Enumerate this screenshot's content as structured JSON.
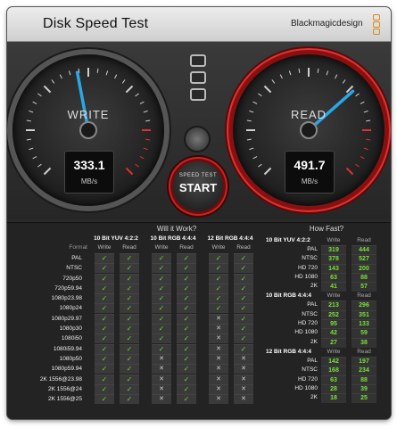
{
  "window": {
    "title": "Disk Speed Test",
    "brand": "Blackmagicdesign"
  },
  "colors": {
    "accent_needle": "#2aa7e8",
    "read_ring": "#d33333",
    "check_green": "#6fd03a",
    "value_green": "#7be03a"
  },
  "gauges": {
    "write": {
      "label": "WRITE",
      "value": "333.1",
      "unit": "MB/s",
      "level": 0.46
    },
    "read": {
      "label": "READ",
      "value": "491.7",
      "unit": "MB/s",
      "level": 0.68
    }
  },
  "controls": {
    "start_small": "SPEED TEST",
    "start_big": "START",
    "settings_icon": "settings-stack-icon",
    "gear_icon": "gear-icon"
  },
  "will_it_work": {
    "title": "Will it Work?",
    "format_header": "Format",
    "groups": [
      "10 Bit YUV 4:2:2",
      "10 Bit RGB 4:4:4",
      "12 Bit RGB 4:4:4"
    ],
    "sub": [
      "Write",
      "Read"
    ],
    "rows": [
      {
        "format": "PAL",
        "cells": [
          1,
          1,
          1,
          1,
          1,
          1
        ]
      },
      {
        "format": "NTSC",
        "cells": [
          1,
          1,
          1,
          1,
          1,
          1
        ]
      },
      {
        "format": "720p50",
        "cells": [
          1,
          1,
          1,
          1,
          1,
          1
        ]
      },
      {
        "format": "720p59.94",
        "cells": [
          1,
          1,
          1,
          1,
          1,
          1
        ]
      },
      {
        "format": "1080p23.98",
        "cells": [
          1,
          1,
          1,
          1,
          1,
          1
        ]
      },
      {
        "format": "1080p24",
        "cells": [
          1,
          1,
          1,
          1,
          1,
          1
        ]
      },
      {
        "format": "1080p29.97",
        "cells": [
          1,
          1,
          1,
          1,
          0,
          1
        ]
      },
      {
        "format": "1080p30",
        "cells": [
          1,
          1,
          1,
          1,
          0,
          1
        ]
      },
      {
        "format": "1080i50",
        "cells": [
          1,
          1,
          1,
          1,
          0,
          1
        ]
      },
      {
        "format": "1080i59.94",
        "cells": [
          1,
          1,
          1,
          1,
          0,
          1
        ]
      },
      {
        "format": "1080p50",
        "cells": [
          1,
          1,
          0,
          1,
          0,
          0
        ]
      },
      {
        "format": "1080p59.94",
        "cells": [
          1,
          1,
          0,
          1,
          0,
          0
        ]
      },
      {
        "format": "2K 1556@23.98",
        "cells": [
          1,
          1,
          0,
          1,
          0,
          0
        ]
      },
      {
        "format": "2K 1556@24",
        "cells": [
          1,
          1,
          0,
          1,
          0,
          0
        ]
      },
      {
        "format": "2K 1556@25",
        "cells": [
          1,
          1,
          0,
          1,
          0,
          0
        ]
      }
    ]
  },
  "how_fast": {
    "title": "How Fast?",
    "groups": [
      {
        "name": "10 Bit YUV 4:2:2",
        "write_h": "Write",
        "read_h": "Read",
        "rows": [
          {
            "name": "PAL",
            "write": "319",
            "read": "444"
          },
          {
            "name": "NTSC",
            "write": "378",
            "read": "527"
          },
          {
            "name": "HD 720",
            "write": "143",
            "read": "200"
          },
          {
            "name": "HD 1080",
            "write": "63",
            "read": "88"
          },
          {
            "name": "2K",
            "write": "41",
            "read": "57"
          }
        ]
      },
      {
        "name": "10 Bit RGB 4:4:4",
        "write_h": "Write",
        "read_h": "Read",
        "rows": [
          {
            "name": "PAL",
            "write": "213",
            "read": "296"
          },
          {
            "name": "NTSC",
            "write": "252",
            "read": "351"
          },
          {
            "name": "HD 720",
            "write": "95",
            "read": "133"
          },
          {
            "name": "HD 1080",
            "write": "42",
            "read": "59"
          },
          {
            "name": "2K",
            "write": "27",
            "read": "38"
          }
        ]
      },
      {
        "name": "12 Bit RGB 4:4:4",
        "write_h": "Write",
        "read_h": "Read",
        "rows": [
          {
            "name": "PAL",
            "write": "142",
            "read": "197"
          },
          {
            "name": "NTSC",
            "write": "168",
            "read": "234"
          },
          {
            "name": "HD 720",
            "write": "63",
            "read": "88"
          },
          {
            "name": "HD 1080",
            "write": "28",
            "read": "39"
          },
          {
            "name": "2K",
            "write": "18",
            "read": "25"
          }
        ]
      }
    ]
  }
}
